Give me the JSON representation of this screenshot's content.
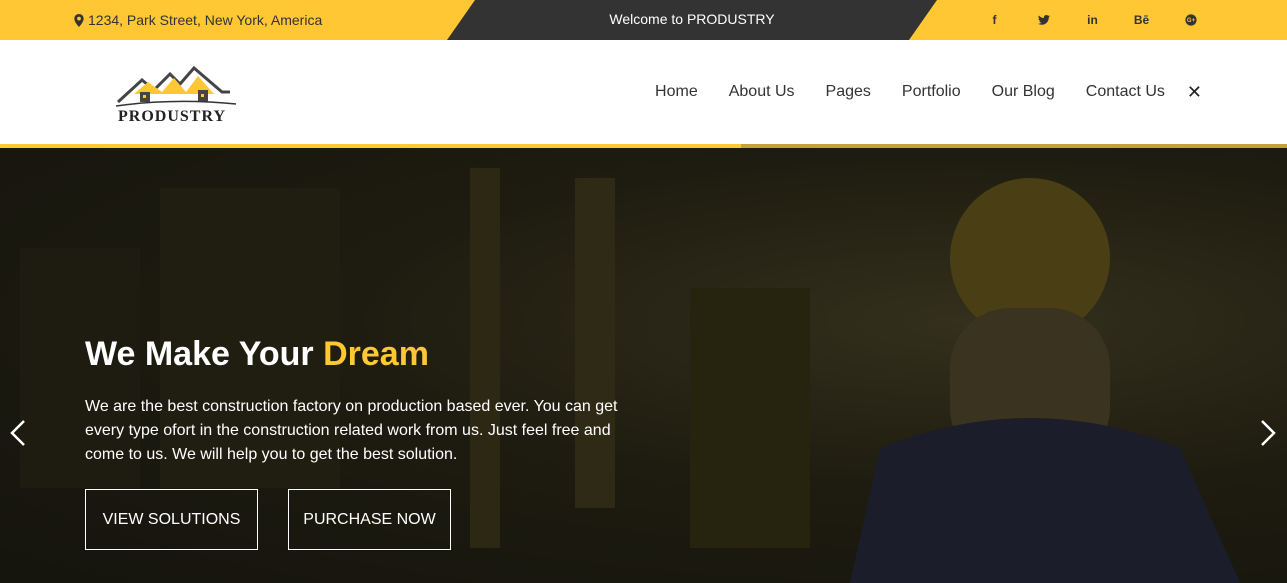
{
  "topbar": {
    "address": "1234, Park Street, New York, America",
    "welcome": "Welcome to PRODUSTRY",
    "social": [
      {
        "name": "facebook-icon",
        "label": "f"
      },
      {
        "name": "twitter-icon",
        "label": ""
      },
      {
        "name": "linkedin-icon",
        "label": "in"
      },
      {
        "name": "behance-icon",
        "label": "Bē"
      },
      {
        "name": "google-plus-icon",
        "label": "G+"
      }
    ]
  },
  "header": {
    "logo_text": "PRODUSTRY",
    "nav": [
      "Home",
      "About Us",
      "Pages",
      "Portfolio",
      "Our Blog",
      "Contact Us"
    ],
    "close": "✕"
  },
  "hero": {
    "title_main": "We Make Your ",
    "title_accent": "Dream",
    "text": "We are the best construction factory on production based ever. You can get every type ofort in the construction related work from us. Just feel free and come to us. We will help you to get the best solution.",
    "button_1": "VIEW SOLUTIONS",
    "button_2": "PURCHASE NOW"
  },
  "colors": {
    "accent": "#fec733",
    "dark": "#333333"
  }
}
